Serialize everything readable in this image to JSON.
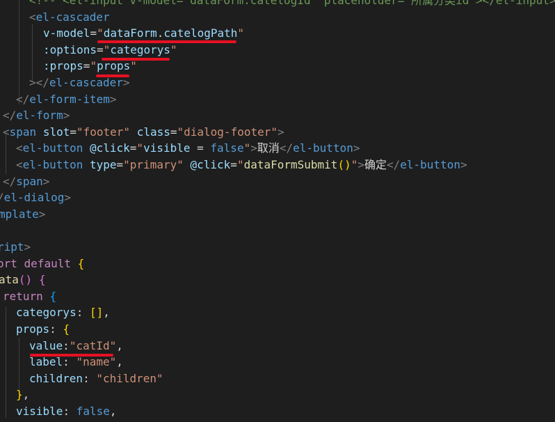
{
  "colors": {
    "background": "#1e1e1e",
    "tag": "#569cd6",
    "bracket": "#808080",
    "attr": "#9cdcfe",
    "string": "#ce9178",
    "text": "#d4d4d4",
    "keyword": "#c586c0",
    "function": "#dcdcaa",
    "brace": "#ffd700",
    "boolean": "#569cd6",
    "annotation": "#e81123"
  },
  "code_lines": [
    {
      "x": 42,
      "tokens": [
        {
          "t": "<!-- ",
          "c": "#6a9955"
        },
        {
          "t": "<el-input v-model=\"dataForm.catelogId\" placeholder=\"所属分类id\"></el-input>",
          "c": "#6a9955"
        }
      ]
    },
    {
      "x": 42,
      "tokens": [
        {
          "t": "<",
          "c": "#808080"
        },
        {
          "t": "el-cascader",
          "c": "#569cd6"
        }
      ]
    },
    {
      "x": 62,
      "tokens": [
        {
          "t": "v-model",
          "c": "#9cdcfe"
        },
        {
          "t": "=",
          "c": "#d4d4d4"
        },
        {
          "t": "\"dataForm.catelogPath\"",
          "c": "#ce9178",
          "sub": [
            {
              "t": "\"",
              "c": "#ce9178"
            },
            {
              "t": "dataForm",
              "c": "#9cdcfe"
            },
            {
              "t": ".",
              "c": "#d4d4d4"
            },
            {
              "t": "catelogPath",
              "c": "#9cdcfe"
            },
            {
              "t": "\"",
              "c": "#ce9178"
            }
          ]
        }
      ]
    },
    {
      "x": 62,
      "tokens": [
        {
          "t": ":options",
          "c": "#9cdcfe"
        },
        {
          "t": "=",
          "c": "#d4d4d4"
        },
        {
          "t": "\"",
          "c": "#ce9178"
        },
        {
          "t": "categorys",
          "c": "#9cdcfe"
        },
        {
          "t": "\"",
          "c": "#ce9178"
        }
      ]
    },
    {
      "x": 62,
      "tokens": [
        {
          "t": ":props",
          "c": "#9cdcfe"
        },
        {
          "t": "=",
          "c": "#d4d4d4"
        },
        {
          "t": "\"",
          "c": "#ce9178"
        },
        {
          "t": "props",
          "c": "#9cdcfe"
        },
        {
          "t": "\"",
          "c": "#ce9178"
        }
      ]
    },
    {
      "x": 42,
      "tokens": [
        {
          "t": "></",
          "c": "#808080"
        },
        {
          "t": "el-cascader",
          "c": "#569cd6"
        },
        {
          "t": ">",
          "c": "#808080"
        }
      ]
    },
    {
      "x": 23,
      "tokens": [
        {
          "t": "</",
          "c": "#808080"
        },
        {
          "t": "el-form-item",
          "c": "#569cd6"
        },
        {
          "t": ">",
          "c": "#808080"
        }
      ]
    },
    {
      "x": 4,
      "tokens": [
        {
          "t": "</",
          "c": "#808080"
        },
        {
          "t": "el-form",
          "c": "#569cd6"
        },
        {
          "t": ">",
          "c": "#808080"
        }
      ]
    },
    {
      "x": 4,
      "tokens": [
        {
          "t": "<",
          "c": "#808080"
        },
        {
          "t": "span",
          "c": "#569cd6"
        },
        {
          "t": " ",
          "c": "#d4d4d4"
        },
        {
          "t": "slot",
          "c": "#9cdcfe"
        },
        {
          "t": "=",
          "c": "#d4d4d4"
        },
        {
          "t": "\"footer\"",
          "c": "#ce9178"
        },
        {
          "t": " ",
          "c": "#d4d4d4"
        },
        {
          "t": "class",
          "c": "#9cdcfe"
        },
        {
          "t": "=",
          "c": "#d4d4d4"
        },
        {
          "t": "\"dialog-footer\"",
          "c": "#ce9178"
        },
        {
          "t": ">",
          "c": "#808080"
        }
      ]
    },
    {
      "x": 23,
      "tokens": [
        {
          "t": "<",
          "c": "#808080"
        },
        {
          "t": "el-button",
          "c": "#569cd6"
        },
        {
          "t": " ",
          "c": "#d4d4d4"
        },
        {
          "t": "@click",
          "c": "#9cdcfe"
        },
        {
          "t": "=",
          "c": "#d4d4d4"
        },
        {
          "t": "\"",
          "c": "#ce9178"
        },
        {
          "t": "visible",
          "c": "#9cdcfe"
        },
        {
          "t": " = ",
          "c": "#d4d4d4"
        },
        {
          "t": "false",
          "c": "#569cd6"
        },
        {
          "t": "\"",
          "c": "#ce9178"
        },
        {
          "t": ">",
          "c": "#808080"
        },
        {
          "t": "取消",
          "c": "#d4d4d4"
        },
        {
          "t": "</",
          "c": "#808080"
        },
        {
          "t": "el-button",
          "c": "#569cd6"
        },
        {
          "t": ">",
          "c": "#808080"
        }
      ]
    },
    {
      "x": 23,
      "tokens": [
        {
          "t": "<",
          "c": "#808080"
        },
        {
          "t": "el-button",
          "c": "#569cd6"
        },
        {
          "t": " ",
          "c": "#d4d4d4"
        },
        {
          "t": "type",
          "c": "#9cdcfe"
        },
        {
          "t": "=",
          "c": "#d4d4d4"
        },
        {
          "t": "\"primary\"",
          "c": "#ce9178"
        },
        {
          "t": " ",
          "c": "#d4d4d4"
        },
        {
          "t": "@click",
          "c": "#9cdcfe"
        },
        {
          "t": "=",
          "c": "#d4d4d4"
        },
        {
          "t": "\"",
          "c": "#ce9178"
        },
        {
          "t": "dataFormSubmit",
          "c": "#dcdcaa"
        },
        {
          "t": "()",
          "c": "#ffd700"
        },
        {
          "t": "\"",
          "c": "#ce9178"
        },
        {
          "t": ">",
          "c": "#808080"
        },
        {
          "t": "确定",
          "c": "#d4d4d4"
        },
        {
          "t": "</",
          "c": "#808080"
        },
        {
          "t": "el-button",
          "c": "#569cd6"
        },
        {
          "t": ">",
          "c": "#808080"
        }
      ]
    },
    {
      "x": 4,
      "tokens": [
        {
          "t": "</",
          "c": "#808080"
        },
        {
          "t": "span",
          "c": "#569cd6"
        },
        {
          "t": ">",
          "c": "#808080"
        }
      ]
    },
    {
      "x": -4,
      "tokens": [
        {
          "t": "/",
          "c": "#808080"
        },
        {
          "t": "el-dialog",
          "c": "#569cd6"
        },
        {
          "t": ">",
          "c": "#808080"
        }
      ]
    },
    {
      "x": -2,
      "tokens": [
        {
          "t": "mplate",
          "c": "#569cd6"
        },
        {
          "t": ">",
          "c": "#808080"
        }
      ]
    },
    {
      "x": 0,
      "tokens": []
    },
    {
      "x": -4,
      "tokens": [
        {
          "t": "ript",
          "c": "#569cd6"
        },
        {
          "t": ">",
          "c": "#808080"
        }
      ]
    },
    {
      "x": -4,
      "tokens": [
        {
          "t": "ort",
          "c": "#c586c0"
        },
        {
          "t": " ",
          "c": "#d4d4d4"
        },
        {
          "t": "default",
          "c": "#c586c0"
        },
        {
          "t": " ",
          "c": "#d4d4d4"
        },
        {
          "t": "{",
          "c": "#ffd700"
        }
      ]
    },
    {
      "x": -2,
      "tokens": [
        {
          "t": "ata",
          "c": "#dcdcaa"
        },
        {
          "t": "()",
          "c": "#da70d6"
        },
        {
          "t": " ",
          "c": "#d4d4d4"
        },
        {
          "t": "{",
          "c": "#da70d6"
        }
      ]
    },
    {
      "x": 4,
      "tokens": [
        {
          "t": "return",
          "c": "#c586c0"
        },
        {
          "t": " ",
          "c": "#d4d4d4"
        },
        {
          "t": "{",
          "c": "#179fff"
        }
      ]
    },
    {
      "x": 23,
      "tokens": [
        {
          "t": "categorys",
          "c": "#9cdcfe"
        },
        {
          "t": ": ",
          "c": "#d4d4d4"
        },
        {
          "t": "[]",
          "c": "#ffd700"
        },
        {
          "t": ",",
          "c": "#d4d4d4"
        }
      ]
    },
    {
      "x": 23,
      "tokens": [
        {
          "t": "props",
          "c": "#9cdcfe"
        },
        {
          "t": ": ",
          "c": "#d4d4d4"
        },
        {
          "t": "{",
          "c": "#ffd700"
        }
      ]
    },
    {
      "x": 42,
      "tokens": [
        {
          "t": "value",
          "c": "#9cdcfe"
        },
        {
          "t": ":",
          "c": "#d4d4d4"
        },
        {
          "t": "\"catId\"",
          "c": "#ce9178"
        },
        {
          "t": ",",
          "c": "#d4d4d4"
        }
      ]
    },
    {
      "x": 42,
      "tokens": [
        {
          "t": "label",
          "c": "#9cdcfe"
        },
        {
          "t": ": ",
          "c": "#d4d4d4"
        },
        {
          "t": "\"name\"",
          "c": "#ce9178"
        },
        {
          "t": ",",
          "c": "#d4d4d4"
        }
      ]
    },
    {
      "x": 42,
      "tokens": [
        {
          "t": "children",
          "c": "#9cdcfe"
        },
        {
          "t": ": ",
          "c": "#d4d4d4"
        },
        {
          "t": "\"children\"",
          "c": "#ce9178"
        }
      ]
    },
    {
      "x": 23,
      "tokens": [
        {
          "t": "}",
          "c": "#ffd700"
        },
        {
          "t": ",",
          "c": "#d4d4d4"
        }
      ]
    },
    {
      "x": 23,
      "tokens": [
        {
          "t": "visible",
          "c": "#9cdcfe"
        },
        {
          "t": ": ",
          "c": "#d4d4d4"
        },
        {
          "t": "false",
          "c": "#569cd6"
        },
        {
          "t": ",",
          "c": "#d4d4d4"
        }
      ]
    }
  ]
}
